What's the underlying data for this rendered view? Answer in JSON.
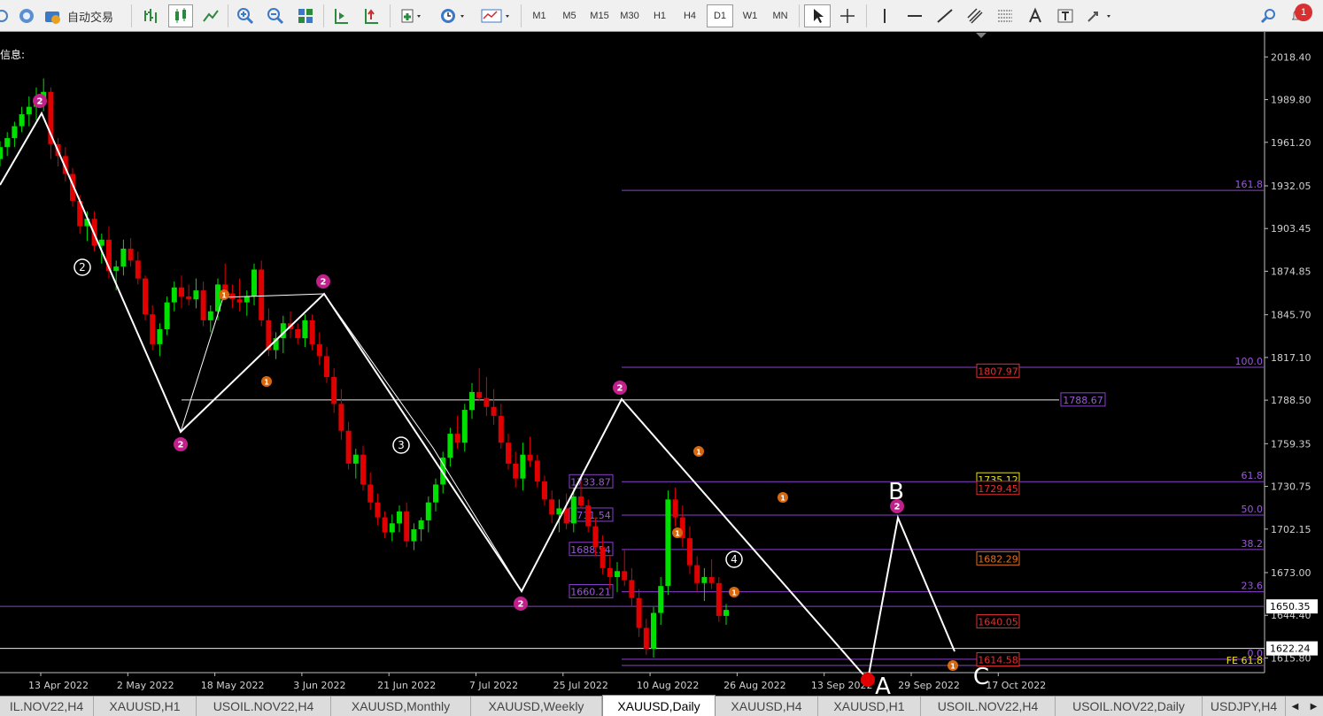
{
  "toolbar": {
    "auto_trading_label": "自动交易",
    "timeframes": [
      "M1",
      "M5",
      "M15",
      "M30",
      "H1",
      "H4",
      "D1",
      "W1",
      "MN"
    ],
    "active_timeframe": "D1",
    "notification_count": "1"
  },
  "chart_data": {
    "type": "candlestick",
    "symbol": "XAUUSD",
    "timeframe": "Daily",
    "corner_text": "信息:",
    "ylim": [
      1606,
      2034
    ],
    "price_ticks": [
      "2018.40",
      "1989.80",
      "1961.20",
      "1932.05",
      "1903.45",
      "1874.85",
      "1845.70",
      "1817.10",
      "1788.50",
      "1759.35",
      "1730.75",
      "1702.15",
      "1673.00",
      "1644.40",
      "1615.80"
    ],
    "date_ticks": [
      "13 Apr 2022",
      "2 May 2022",
      "18 May 2022",
      "3 Jun 2022",
      "21 Jun 2022",
      "7 Jul 2022",
      "25 Jul 2022",
      "10 Aug 2022",
      "26 Aug 2022",
      "13 Sep 2022",
      "29 Sep 2022",
      "17 Oct 2022"
    ],
    "current_price": "1650.35",
    "line_price": "1622.24",
    "fib_levels": [
      {
        "label": "161.8",
        "price": 1929.0
      },
      {
        "label": "100.0",
        "price": 1810.5
      },
      {
        "label": "61.8",
        "price": 1733.9
      },
      {
        "label": "50.0",
        "price": 1711.5
      },
      {
        "label": "38.2",
        "price": 1688.5
      },
      {
        "label": "23.6",
        "price": 1660.2
      },
      {
        "label": "0.0",
        "price": 1615.0
      }
    ],
    "fe_label": "FE 61.8",
    "left_price_labels": [
      "1733.87",
      "1711.54",
      "1688.54",
      "1660.21"
    ],
    "right_price_labels": [
      "1807.97",
      "1735.12",
      "1729.45",
      "1682.29",
      "1640.05",
      "1614.58"
    ],
    "horizontal_level_label": "1788.67",
    "wave_labels": {
      "A": "A",
      "B": "B",
      "C": "C"
    },
    "wave_markers": [
      "2",
      "1",
      "3",
      "4"
    ],
    "ohlc": [
      [
        1950,
        1962,
        1945,
        1958
      ],
      [
        1958,
        1968,
        1952,
        1964
      ],
      [
        1964,
        1975,
        1958,
        1972
      ],
      [
        1972,
        1985,
        1968,
        1980
      ],
      [
        1980,
        1992,
        1972,
        1985
      ],
      [
        1985,
        1998,
        1976,
        1990
      ],
      [
        1990,
        2004,
        1982,
        1995
      ],
      [
        1995,
        1998,
        1950,
        1960
      ],
      [
        1960,
        1964,
        1945,
        1952
      ],
      [
        1952,
        1958,
        1935,
        1940
      ],
      [
        1940,
        1944,
        1918,
        1922
      ],
      [
        1922,
        1926,
        1900,
        1905
      ],
      [
        1905,
        1915,
        1895,
        1910
      ],
      [
        1910,
        1915,
        1888,
        1892
      ],
      [
        1892,
        1900,
        1880,
        1896
      ],
      [
        1896,
        1905,
        1870,
        1875
      ],
      [
        1875,
        1882,
        1862,
        1878
      ],
      [
        1878,
        1896,
        1872,
        1890
      ],
      [
        1890,
        1897,
        1878,
        1882
      ],
      [
        1882,
        1888,
        1866,
        1870
      ],
      [
        1870,
        1872,
        1842,
        1846
      ],
      [
        1846,
        1852,
        1822,
        1826
      ],
      [
        1826,
        1840,
        1818,
        1836
      ],
      [
        1836,
        1858,
        1832,
        1854
      ],
      [
        1854,
        1868,
        1848,
        1864
      ],
      [
        1864,
        1872,
        1850,
        1858
      ],
      [
        1858,
        1866,
        1852,
        1856
      ],
      [
        1856,
        1870,
        1850,
        1862
      ],
      [
        1862,
        1868,
        1838,
        1842
      ],
      [
        1842,
        1852,
        1834,
        1848
      ],
      [
        1848,
        1870,
        1842,
        1866
      ],
      [
        1866,
        1880,
        1856,
        1860
      ],
      [
        1860,
        1866,
        1850,
        1856
      ],
      [
        1856,
        1870,
        1848,
        1854
      ],
      [
        1854,
        1862,
        1845,
        1858
      ],
      [
        1858,
        1880,
        1852,
        1876
      ],
      [
        1876,
        1882,
        1838,
        1842
      ],
      [
        1842,
        1850,
        1818,
        1822
      ],
      [
        1822,
        1834,
        1816,
        1830
      ],
      [
        1830,
        1845,
        1820,
        1840
      ],
      [
        1840,
        1848,
        1830,
        1836
      ],
      [
        1836,
        1840,
        1826,
        1830
      ],
      [
        1830,
        1846,
        1824,
        1842
      ],
      [
        1842,
        1846,
        1822,
        1826
      ],
      [
        1826,
        1834,
        1812,
        1818
      ],
      [
        1818,
        1824,
        1800,
        1804
      ],
      [
        1804,
        1810,
        1780,
        1786
      ],
      [
        1786,
        1796,
        1762,
        1768
      ],
      [
        1768,
        1774,
        1742,
        1746
      ],
      [
        1746,
        1756,
        1736,
        1752
      ],
      [
        1752,
        1758,
        1728,
        1732
      ],
      [
        1732,
        1740,
        1715,
        1720
      ],
      [
        1720,
        1726,
        1705,
        1710
      ],
      [
        1710,
        1714,
        1696,
        1700
      ],
      [
        1700,
        1712,
        1694,
        1706
      ],
      [
        1706,
        1718,
        1700,
        1714
      ],
      [
        1714,
        1720,
        1690,
        1694
      ],
      [
        1694,
        1706,
        1688,
        1702
      ],
      [
        1702,
        1710,
        1694,
        1708
      ],
      [
        1708,
        1724,
        1700,
        1720
      ],
      [
        1720,
        1736,
        1714,
        1732
      ],
      [
        1732,
        1754,
        1726,
        1750
      ],
      [
        1750,
        1770,
        1744,
        1766
      ],
      [
        1766,
        1778,
        1756,
        1760
      ],
      [
        1760,
        1786,
        1754,
        1782
      ],
      [
        1782,
        1800,
        1776,
        1794
      ],
      [
        1794,
        1810,
        1788,
        1790
      ],
      [
        1790,
        1804,
        1778,
        1784
      ],
      [
        1784,
        1796,
        1772,
        1778
      ],
      [
        1778,
        1786,
        1756,
        1760
      ],
      [
        1760,
        1766,
        1742,
        1746
      ],
      [
        1746,
        1754,
        1730,
        1736
      ],
      [
        1736,
        1760,
        1728,
        1752
      ],
      [
        1752,
        1764,
        1744,
        1748
      ],
      [
        1748,
        1752,
        1730,
        1734
      ],
      [
        1734,
        1738,
        1718,
        1722
      ],
      [
        1722,
        1728,
        1706,
        1712
      ],
      [
        1712,
        1722,
        1700,
        1716
      ],
      [
        1716,
        1726,
        1702,
        1706
      ],
      [
        1706,
        1730,
        1700,
        1724
      ],
      [
        1724,
        1734,
        1716,
        1718
      ],
      [
        1718,
        1722,
        1700,
        1704
      ],
      [
        1704,
        1710,
        1684,
        1690
      ],
      [
        1690,
        1698,
        1672,
        1676
      ],
      [
        1676,
        1684,
        1662,
        1670
      ],
      [
        1670,
        1680,
        1660,
        1674
      ],
      [
        1674,
        1688,
        1664,
        1668
      ],
      [
        1668,
        1676,
        1650,
        1656
      ],
      [
        1656,
        1662,
        1630,
        1636
      ],
      [
        1636,
        1642,
        1618,
        1622
      ],
      [
        1622,
        1650,
        1616,
        1646
      ],
      [
        1646,
        1670,
        1638,
        1664
      ],
      [
        1664,
        1728,
        1658,
        1722
      ],
      [
        1722,
        1730,
        1704,
        1710
      ],
      [
        1710,
        1718,
        1690,
        1696
      ],
      [
        1696,
        1704,
        1672,
        1678
      ],
      [
        1678,
        1684,
        1660,
        1666
      ],
      [
        1666,
        1676,
        1654,
        1670
      ],
      [
        1670,
        1682,
        1662,
        1666
      ],
      [
        1666,
        1670,
        1640,
        1644
      ],
      [
        1644,
        1652,
        1638,
        1648
      ]
    ]
  },
  "tabs": [
    "IL.NOV22,H4",
    "XAUUSD,H1",
    "USOIL.NOV22,H4",
    "XAUUSD,Monthly",
    "XAUUSD,Weekly",
    "XAUUSD,Daily",
    "XAUUSD,H4",
    "XAUUSD,H1",
    "USOIL.NOV22,H4",
    "USOIL.NOV22,Daily",
    "USDJPY,H4"
  ],
  "active_tab": "XAUUSD,Daily",
  "tab_nav": {
    "left": "◀",
    "right": "▶"
  }
}
